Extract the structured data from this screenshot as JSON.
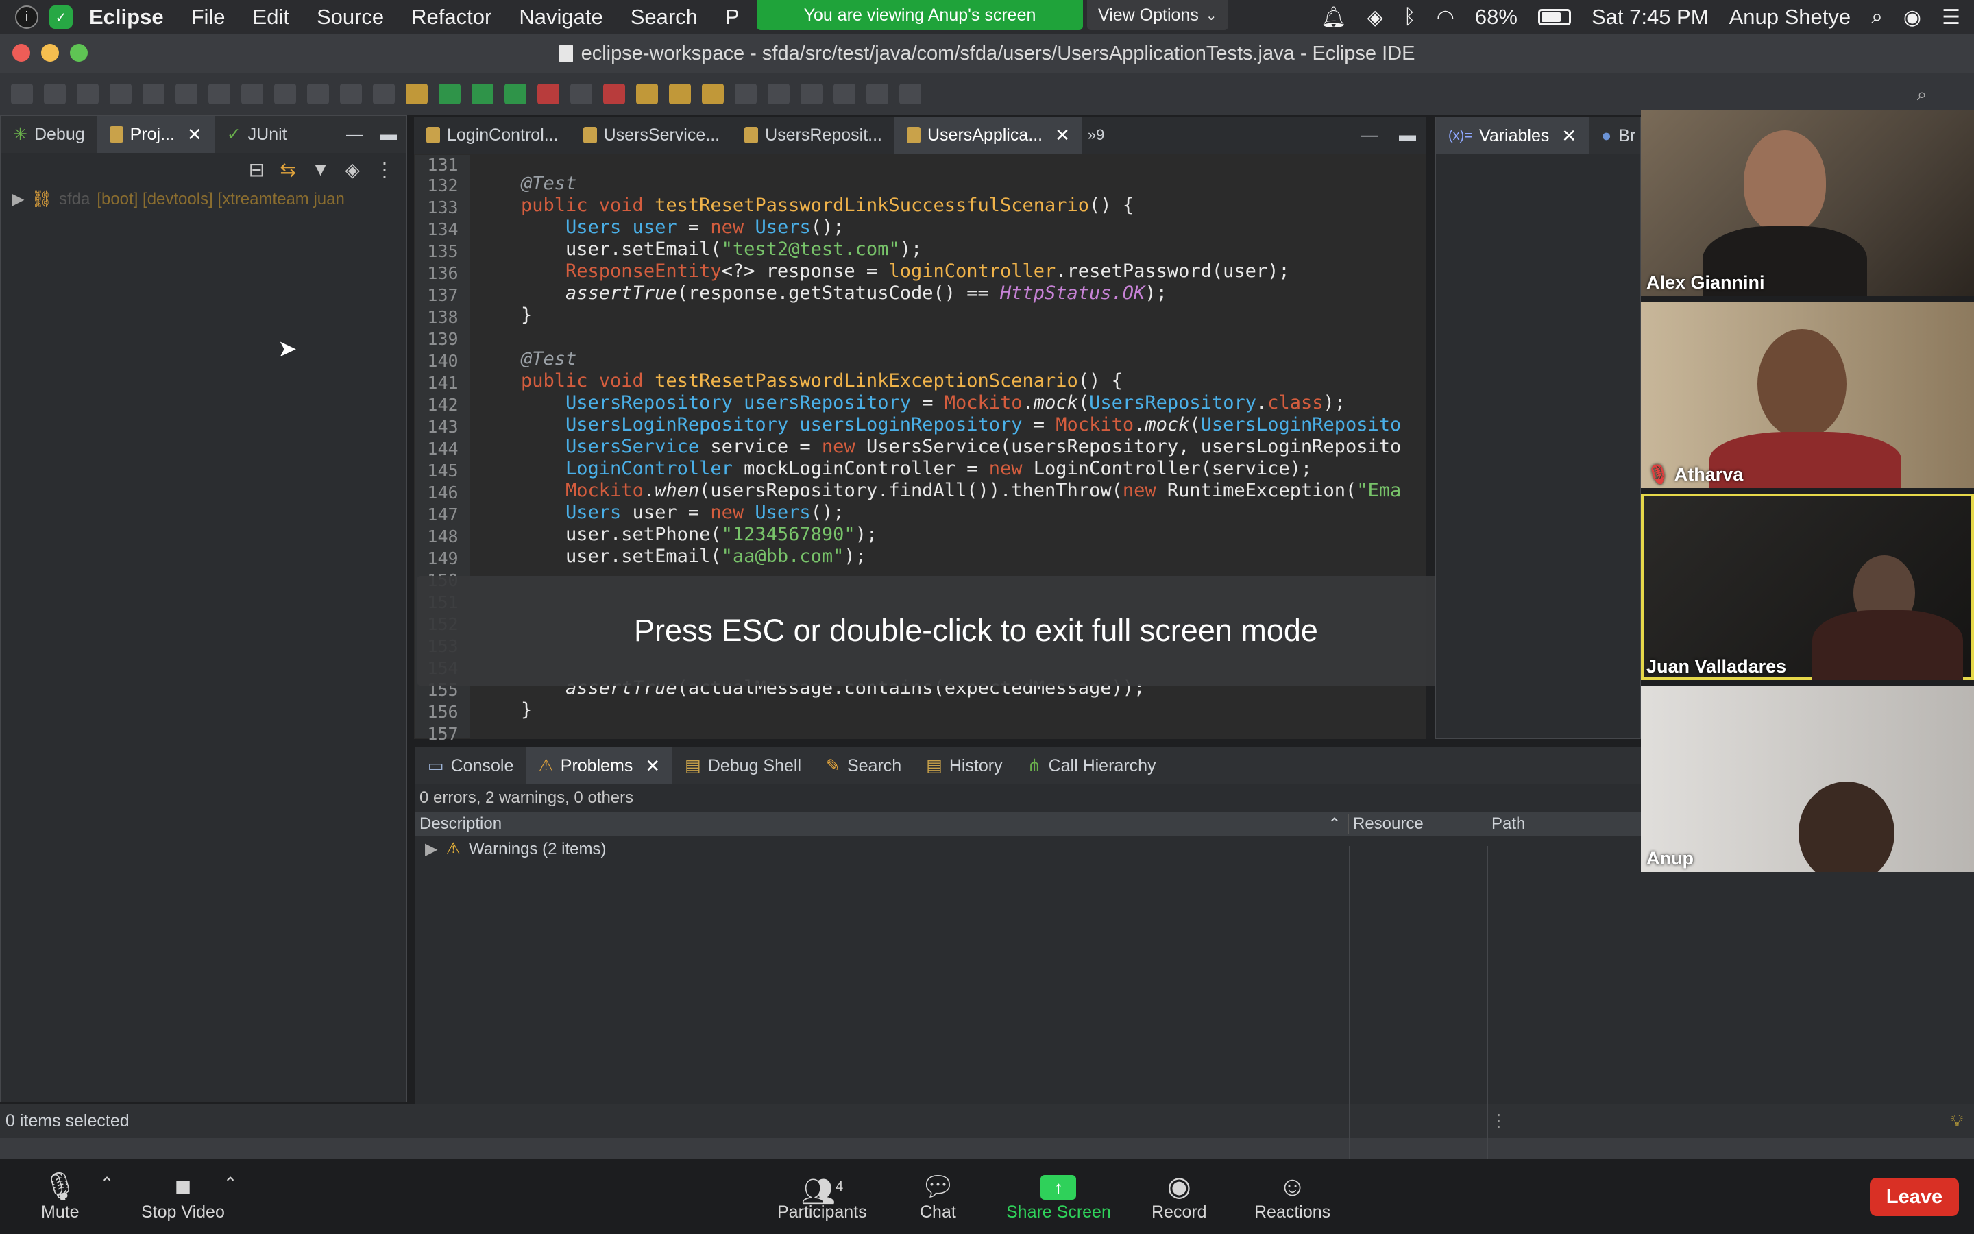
{
  "menubar": {
    "app": "Eclipse",
    "items": [
      "File",
      "Edit",
      "Source",
      "Refactor",
      "Navigate",
      "Search",
      "P"
    ],
    "viewing_banner": "You are viewing Anup's screen",
    "view_options": "View Options",
    "battery": "68%",
    "clock": "Sat 7:45 PM",
    "user": "Anup Shetye"
  },
  "window": {
    "title": "eclipse-workspace - sfda/src/test/java/com/sfda/users/UsersApplicationTests.java - Eclipse IDE"
  },
  "left_panel": {
    "tabs": [
      {
        "label": "Debug"
      },
      {
        "label": "Proj..."
      },
      {
        "label": "JUnit"
      }
    ],
    "tree_item_name": "sfda",
    "tree_item_meta": "[boot] [devtools] [xtreamteam juan",
    "status": "0 items selected"
  },
  "editor": {
    "tabs": [
      {
        "label": "LoginControl..."
      },
      {
        "label": "UsersService..."
      },
      {
        "label": "UsersReposit..."
      },
      {
        "label": "UsersApplica..."
      }
    ],
    "overflow": "»9",
    "line_numbers": [
      "131",
      "132",
      "133",
      "134",
      "135",
      "136",
      "137",
      "138",
      "139",
      "140",
      "141",
      "142",
      "143",
      "144",
      "145",
      "146",
      "147",
      "148",
      "149",
      "150",
      "151",
      "152",
      "153",
      "154",
      "155",
      "156",
      "157"
    ]
  },
  "right_panel": {
    "tabs": [
      {
        "label": "Variables"
      },
      {
        "label": "Br"
      }
    ]
  },
  "bottom_panel": {
    "tabs": [
      {
        "label": "Console"
      },
      {
        "label": "Problems"
      },
      {
        "label": "Debug Shell"
      },
      {
        "label": "Search"
      },
      {
        "label": "History"
      },
      {
        "label": "Call Hierarchy"
      }
    ],
    "summary": "0 errors, 2 warnings, 0 others",
    "columns": [
      "Description",
      "Resource",
      "Path"
    ],
    "rows": [
      {
        "label": "Warnings (2 items)"
      }
    ]
  },
  "fullscreen_toast": "Press ESC or double-click to exit full screen mode",
  "participants": [
    {
      "name": "Alex Giannini"
    },
    {
      "name": "Atharva"
    },
    {
      "name": "Juan Valladares"
    },
    {
      "name": "Anup"
    }
  ],
  "zoom_controls": {
    "mute": "Mute",
    "stop_video": "Stop Video",
    "participants": "Participants",
    "participants_count": "4",
    "chat": "Chat",
    "share_screen": "Share Screen",
    "record": "Record",
    "reactions": "Reactions",
    "leave": "Leave"
  },
  "colors": {
    "banner_green": "#1fa33a",
    "leave_red": "#d93025",
    "share_green": "#2fd15a"
  }
}
